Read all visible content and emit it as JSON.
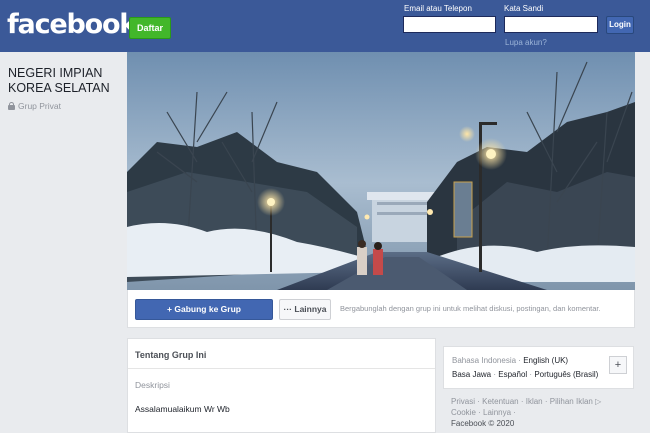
{
  "header": {
    "logo": "facebook",
    "signup_label": "Daftar",
    "email_label": "Email atau Telepon",
    "password_label": "Kata Sandi",
    "email_value": "",
    "password_value": "",
    "login_label": "Login",
    "forgot_label": "Lupa akun?"
  },
  "group": {
    "name_line1": "NEGERI IMPIAN",
    "name_line2": "KOREA SELATAN",
    "privacy": "Grup Privat"
  },
  "actions": {
    "join_label": "Gabung ke Grup",
    "join_icon": "plus-icon",
    "more_label": "Lainnya",
    "more_icon": "ellipsis-icon",
    "hint": "Bergabunglah dengan grup ini untuk melihat diskusi, postingan, dan komentar."
  },
  "about": {
    "title": "Tentang Grup Ini",
    "description_label": "Deskripsi",
    "description_text": "Assalamualaikum Wr Wb"
  },
  "languages": {
    "current": "Bahasa Indonesia",
    "options": [
      "English (UK)",
      "Basa Jawa",
      "Español",
      "Português (Brasil)"
    ]
  },
  "footer": {
    "links": [
      "Privasi",
      "Ketentuan",
      "Iklan",
      "Pilihan Iklan",
      "Cookie",
      "Lainnya"
    ],
    "copyright": "Facebook © 2020"
  },
  "colors": {
    "brand": "#3b5998",
    "signup": "#42b72a",
    "button": "#4267b2"
  }
}
